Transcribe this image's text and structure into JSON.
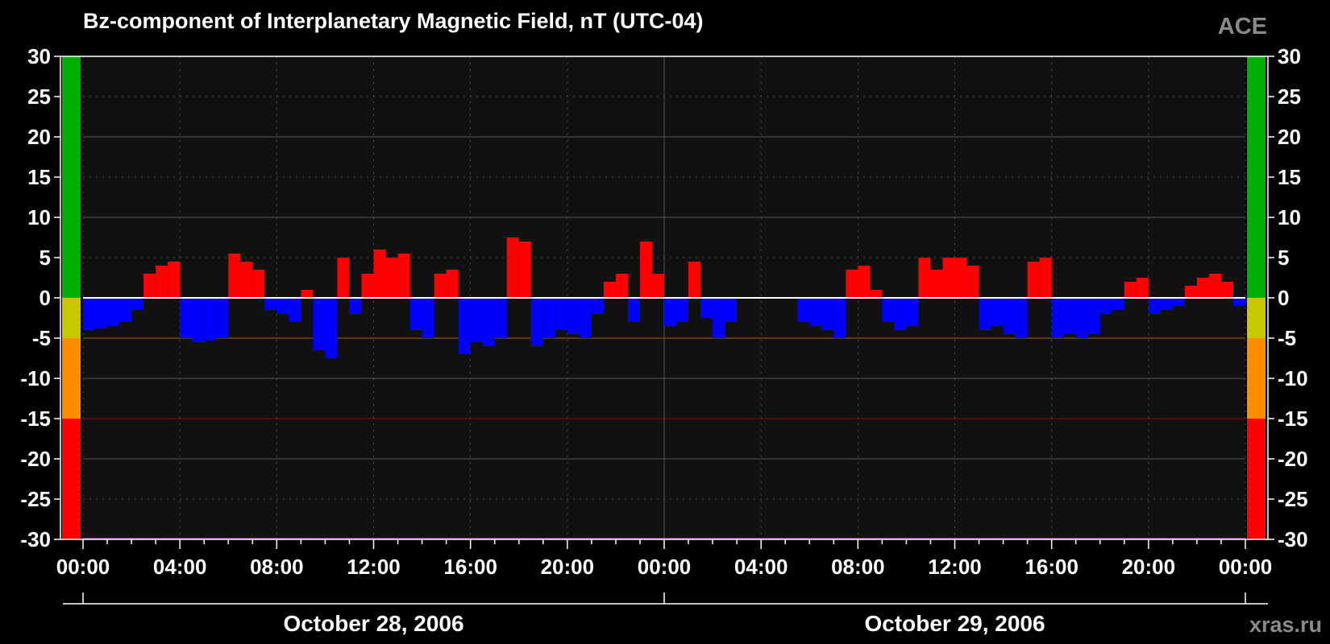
{
  "header": {
    "title": "Bz-component of Interplanetary Magnetic Field, nT (UTC-04)",
    "source_badge": "ACE",
    "credit": "xras.ru"
  },
  "colors": {
    "background": "#000000",
    "plot_background": "#111111",
    "positive_bz": "#ff0000",
    "negative_bz": "#0000ff",
    "zone_green": "#00b000",
    "zone_yellow": "#c8c800",
    "zone_orange": "#ff8c00",
    "zone_red": "#ff0000"
  },
  "chart_data": {
    "type": "bar",
    "title": "Bz-component of Interplanetary Magnetic Field, nT (UTC-04)",
    "xlabel": "",
    "ylabel": "",
    "ylim": [
      -30,
      30
    ],
    "yticks": [
      "30",
      "25",
      "20",
      "15",
      "10",
      "5",
      "0",
      "-5",
      "-10",
      "-15",
      "-20",
      "-25",
      "-30"
    ],
    "xlim_hours": [
      0,
      48
    ],
    "xticks": [
      "00:00",
      "04:00",
      "08:00",
      "12:00",
      "16:00",
      "20:00",
      "00:00",
      "04:00",
      "08:00",
      "12:00",
      "16:00",
      "20:00",
      "00:00"
    ],
    "dates": [
      "October 28, 2006",
      "October 29, 2006"
    ],
    "threshold_zones": [
      {
        "from": 0,
        "to": 30,
        "color": "green"
      },
      {
        "from": -5,
        "to": 0,
        "color": "yellow"
      },
      {
        "from": -15,
        "to": -5,
        "color": "orange"
      },
      {
        "from": -30,
        "to": -15,
        "color": "red"
      }
    ],
    "gaps_hours": [
      [
        27.0,
        29.5
      ]
    ],
    "series": [
      {
        "x_hours": [
          0.0,
          0.5,
          1.0,
          1.5,
          2.0,
          2.5,
          3.0,
          3.5,
          4.0,
          4.5,
          5.0,
          5.5,
          6.0,
          6.5,
          7.0,
          7.5,
          8.0,
          8.5,
          9.0,
          9.5,
          10.0,
          10.5,
          11.0,
          11.5,
          12.0,
          12.5,
          13.0,
          13.5,
          14.0,
          14.5,
          15.0,
          15.5,
          16.0,
          16.5,
          17.0,
          17.5,
          18.0,
          18.5,
          19.0,
          19.5,
          20.0,
          20.5,
          21.0,
          21.5,
          22.0,
          22.5,
          23.0,
          23.5,
          24.0,
          24.5,
          25.0,
          25.5,
          26.0,
          26.5,
          29.5,
          30.0,
          30.5,
          31.0,
          31.5,
          32.0,
          32.5,
          33.0,
          33.5,
          34.0,
          34.5,
          35.0,
          35.5,
          36.0,
          36.5,
          37.0,
          37.5,
          38.0,
          38.5,
          39.0,
          39.5,
          40.0,
          40.5,
          41.0,
          41.5,
          42.0,
          42.5,
          43.0,
          43.5,
          44.0,
          44.5,
          45.0,
          45.5,
          46.0,
          46.5,
          47.0,
          47.5
        ],
        "values": [
          -4,
          -3.8,
          -3.5,
          -3,
          -1.5,
          3,
          4,
          4.5,
          -5,
          -5.5,
          -5.3,
          -5,
          5.5,
          4.5,
          3.5,
          -1.5,
          -2,
          -3,
          1,
          -6.5,
          -7.5,
          5,
          -2,
          3,
          6,
          5,
          5.5,
          -4,
          -5,
          3,
          3.5,
          -7,
          -5.5,
          -6,
          -5,
          7.5,
          7,
          -6,
          -5,
          -4,
          -4.5,
          -5,
          -2,
          2,
          3,
          -3,
          7,
          3,
          -3.5,
          -3,
          4.5,
          -2.5,
          -5,
          -3,
          -3,
          -3.5,
          -4,
          -5,
          3.5,
          4,
          1,
          -3,
          -4,
          -3.5,
          5,
          3.5,
          5,
          5,
          4,
          -4,
          -3.5,
          -4.5,
          -5,
          4.5,
          5,
          -5,
          -4.5,
          -5,
          -4.5,
          -2,
          -1.5,
          2,
          2.5,
          -2,
          -1.5,
          -1,
          1.5,
          2.5,
          3,
          2,
          -1
        ]
      }
    ]
  }
}
